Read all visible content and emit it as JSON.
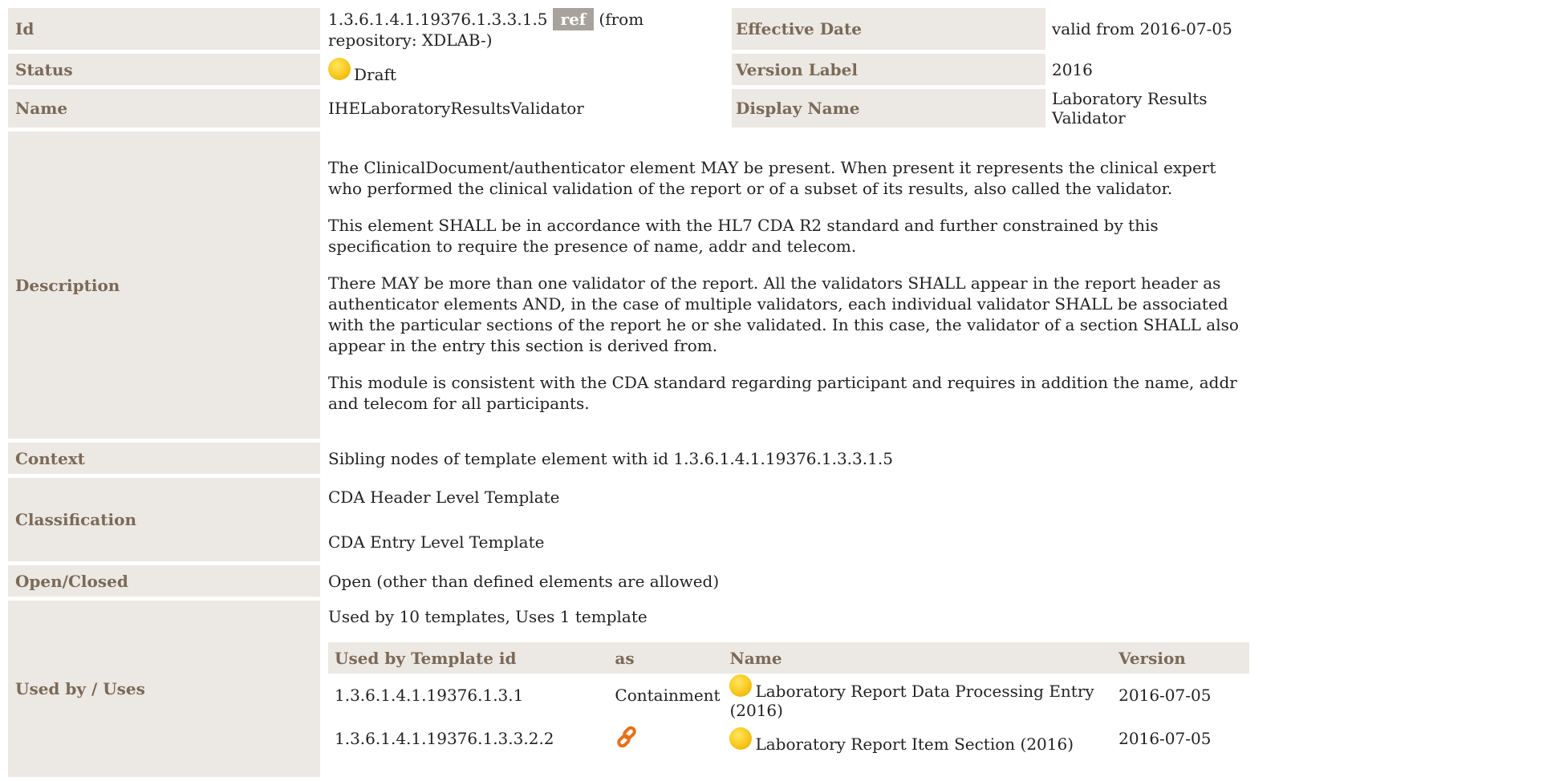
{
  "rows": {
    "id": {
      "label": "Id",
      "value": "1.3.6.1.4.1.19376.1.3.3.1.5",
      "ref_badge": "ref",
      "repository": "(from repository: XDLAB-)"
    },
    "effective_date": {
      "label": "Effective Date",
      "value": "valid from 2016-07-05"
    },
    "status": {
      "label": "Status",
      "value": "Draft",
      "icon": "draft-status-icon",
      "icon_color": "#f7c71d"
    },
    "version_label": {
      "label": "Version Label",
      "value": "2016"
    },
    "name": {
      "label": "Name",
      "value": "IHELaboratoryResultsValidator"
    },
    "display_name": {
      "label": "Display Name",
      "value": "Laboratory Results Validator"
    },
    "description": {
      "label": "Description",
      "paragraphs": [
        "The ClinicalDocument/authenticator element MAY be present. When present it represents the clinical expert who performed the clinical validation of the report or of a subset of its results, also called the validator.",
        "This element SHALL be in accordance with the HL7 CDA R2 standard and further constrained by this specification to require the presence of name, addr and telecom.",
        "There MAY be more than one validator of the report. All the validators SHALL appear in the report header as authenticator elements AND, in the case of multiple validators, each individual validator SHALL be associated with the particular sections of the report he or she validated. In this case, the validator of a section SHALL also appear in the entry this section is derived from.",
        "This module is consistent with the CDA standard regarding participant and requires in addition the name, addr and telecom for all participants."
      ]
    },
    "context": {
      "label": "Context",
      "value": "Sibling nodes of template element with id 1.3.6.1.4.1.19376.1.3.3.1.5"
    },
    "classification": {
      "label": "Classification",
      "values": [
        "CDA Header Level Template",
        "CDA Entry Level Template"
      ]
    },
    "open_closed": {
      "label": "Open/Closed",
      "value": "Open (other than defined elements are allowed)"
    },
    "used_by": {
      "label": "Used by / Uses",
      "caption": "Used by 10 templates, Uses 1 template",
      "columns": [
        "Used by Template id",
        "as",
        "Name",
        "Version"
      ],
      "rows": [
        {
          "id": "1.3.6.1.4.1.19376.1.3.1",
          "as": "Containment",
          "as_icon": null,
          "name": "Laboratory Report Data Processing Entry (2016)",
          "version": "2016-07-05"
        },
        {
          "id": "1.3.6.1.4.1.19376.1.3.3.2.2",
          "as": "",
          "as_icon": "link-icon",
          "name": "Laboratory Report Item Section (2016)",
          "version": "2016-07-05"
        }
      ]
    }
  },
  "colors": {
    "label_bg": "#ece8e3",
    "label_text": "#7a6a58",
    "ref_badge_bg": "#a7a29c",
    "link_icon": "#e8701a"
  }
}
